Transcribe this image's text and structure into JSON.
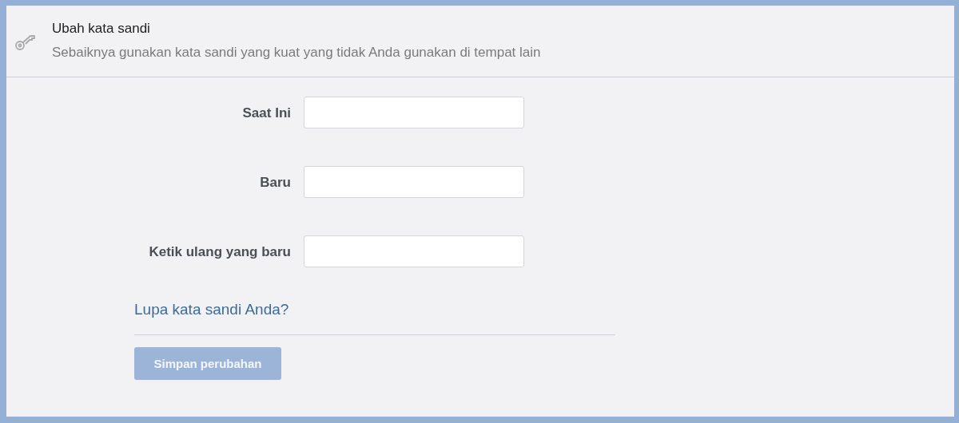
{
  "header": {
    "title": "Ubah kata sandi",
    "subtitle": "Sebaiknya gunakan kata sandi yang kuat yang tidak Anda gunakan di tempat lain"
  },
  "fields": [
    {
      "label": "Saat Ini"
    },
    {
      "label": "Baru"
    },
    {
      "label": "Ketik ulang yang baru"
    }
  ],
  "forgot_link": "Lupa kata sandi Anda?",
  "save_button": {
    "label": "Simpan perubahan",
    "disabled": true
  }
}
